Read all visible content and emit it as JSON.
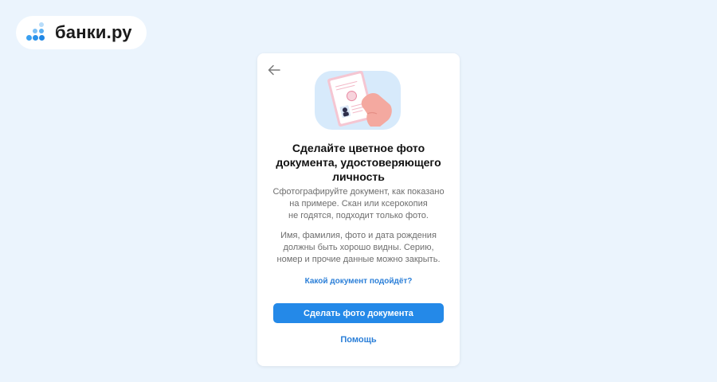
{
  "brand": {
    "name": "банки.ру",
    "accent_color": "#3aa0f0"
  },
  "card": {
    "back_icon": "arrow-left-icon",
    "illustration_icon": "passport-in-hand-icon",
    "title_lines": [
      "Сделайте цветное фото",
      "документа, удостоверяющего",
      "личность"
    ],
    "description_1": [
      "Сфотографируйте документ, как показано",
      "на примере. Скан или ксерокопия",
      "не годятся, подходит только фото."
    ],
    "description_2": [
      "Имя, фамилия, фото и дата рождения",
      "должны быть хорошо видны. Серию,",
      "номер и прочие данные можно закрыть."
    ],
    "which_document_link": "Какой документ подойдёт?",
    "primary_button": "Сделать фото документа",
    "help_link": "Помощь"
  },
  "colors": {
    "page_background": "#ebf4fd",
    "primary": "#2489e8",
    "link": "#2b7fd8"
  }
}
